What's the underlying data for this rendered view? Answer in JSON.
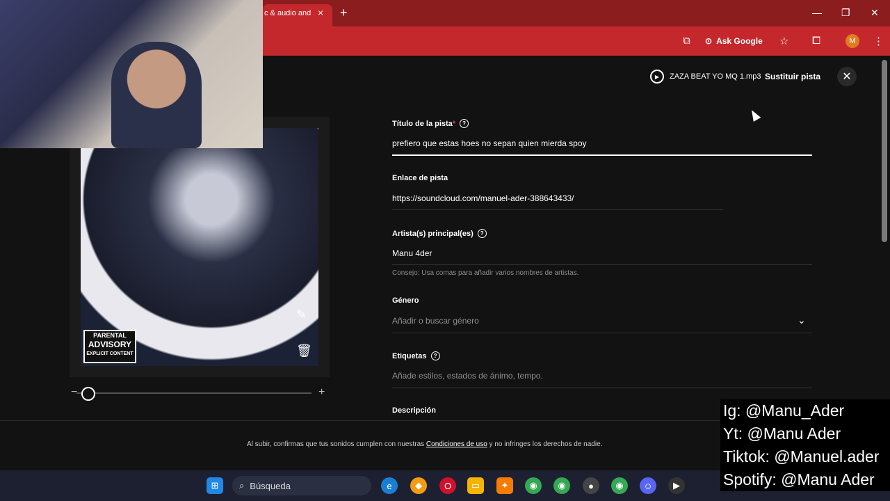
{
  "browser": {
    "tab_title": "c & audio and",
    "tab_close": "×",
    "new_tab": "+",
    "ask_google": "Ask Google",
    "profile_initial": "M"
  },
  "upload": {
    "file_name": "ZAZA BEAT YO MQ 1.mp3",
    "replace_label": "Sustituir pista",
    "close_label": "✕"
  },
  "form": {
    "title_label": "Título de la pista",
    "title_required": "*",
    "title_value": "prefiero que estas hoes no sepan quien mierda spoy",
    "link_label": "Enlace de pista",
    "link_value": "https://soundcloud.com/manuel-ader-388643433/",
    "artist_label": "Artista(s) principal(es)",
    "artist_value": "Manu 4der",
    "artist_hint": "Consejo: Usa comas para añadir varios nombres de artistas.",
    "genre_label": "Género",
    "genre_placeholder": "Añadir o buscar género",
    "tags_label": "Etiquetas",
    "tags_placeholder": "Añade estilos, estados de ánimo, tempo.",
    "description_label": "Descripción"
  },
  "artwork": {
    "advisory_line1": "PARENTAL",
    "advisory_line2": "ADVISORY",
    "advisory_line3": "EXPLICIT CONTENT",
    "zoom_level": 0.05
  },
  "footer": {
    "text_before": "Al subir, confirmas que tus sonidos cumplen con nuestras ",
    "link": "Condiciones de uso",
    "text_after": " y no infringes los derechos de nadie."
  },
  "taskbar": {
    "search_label": "Búsqueda"
  },
  "overlay": {
    "instagram": "Ig: @Manu_Ader",
    "youtube": "Yt: @Manu Ader",
    "tiktok": "Tiktok: @Manuel.ader",
    "spotify": "Spotify: @Manu Ader"
  },
  "colors": {
    "chrome_dark": "#8b1d1f",
    "chrome_accent": "#c4282c",
    "page_bg": "#121212",
    "required": "#e14b4b"
  }
}
